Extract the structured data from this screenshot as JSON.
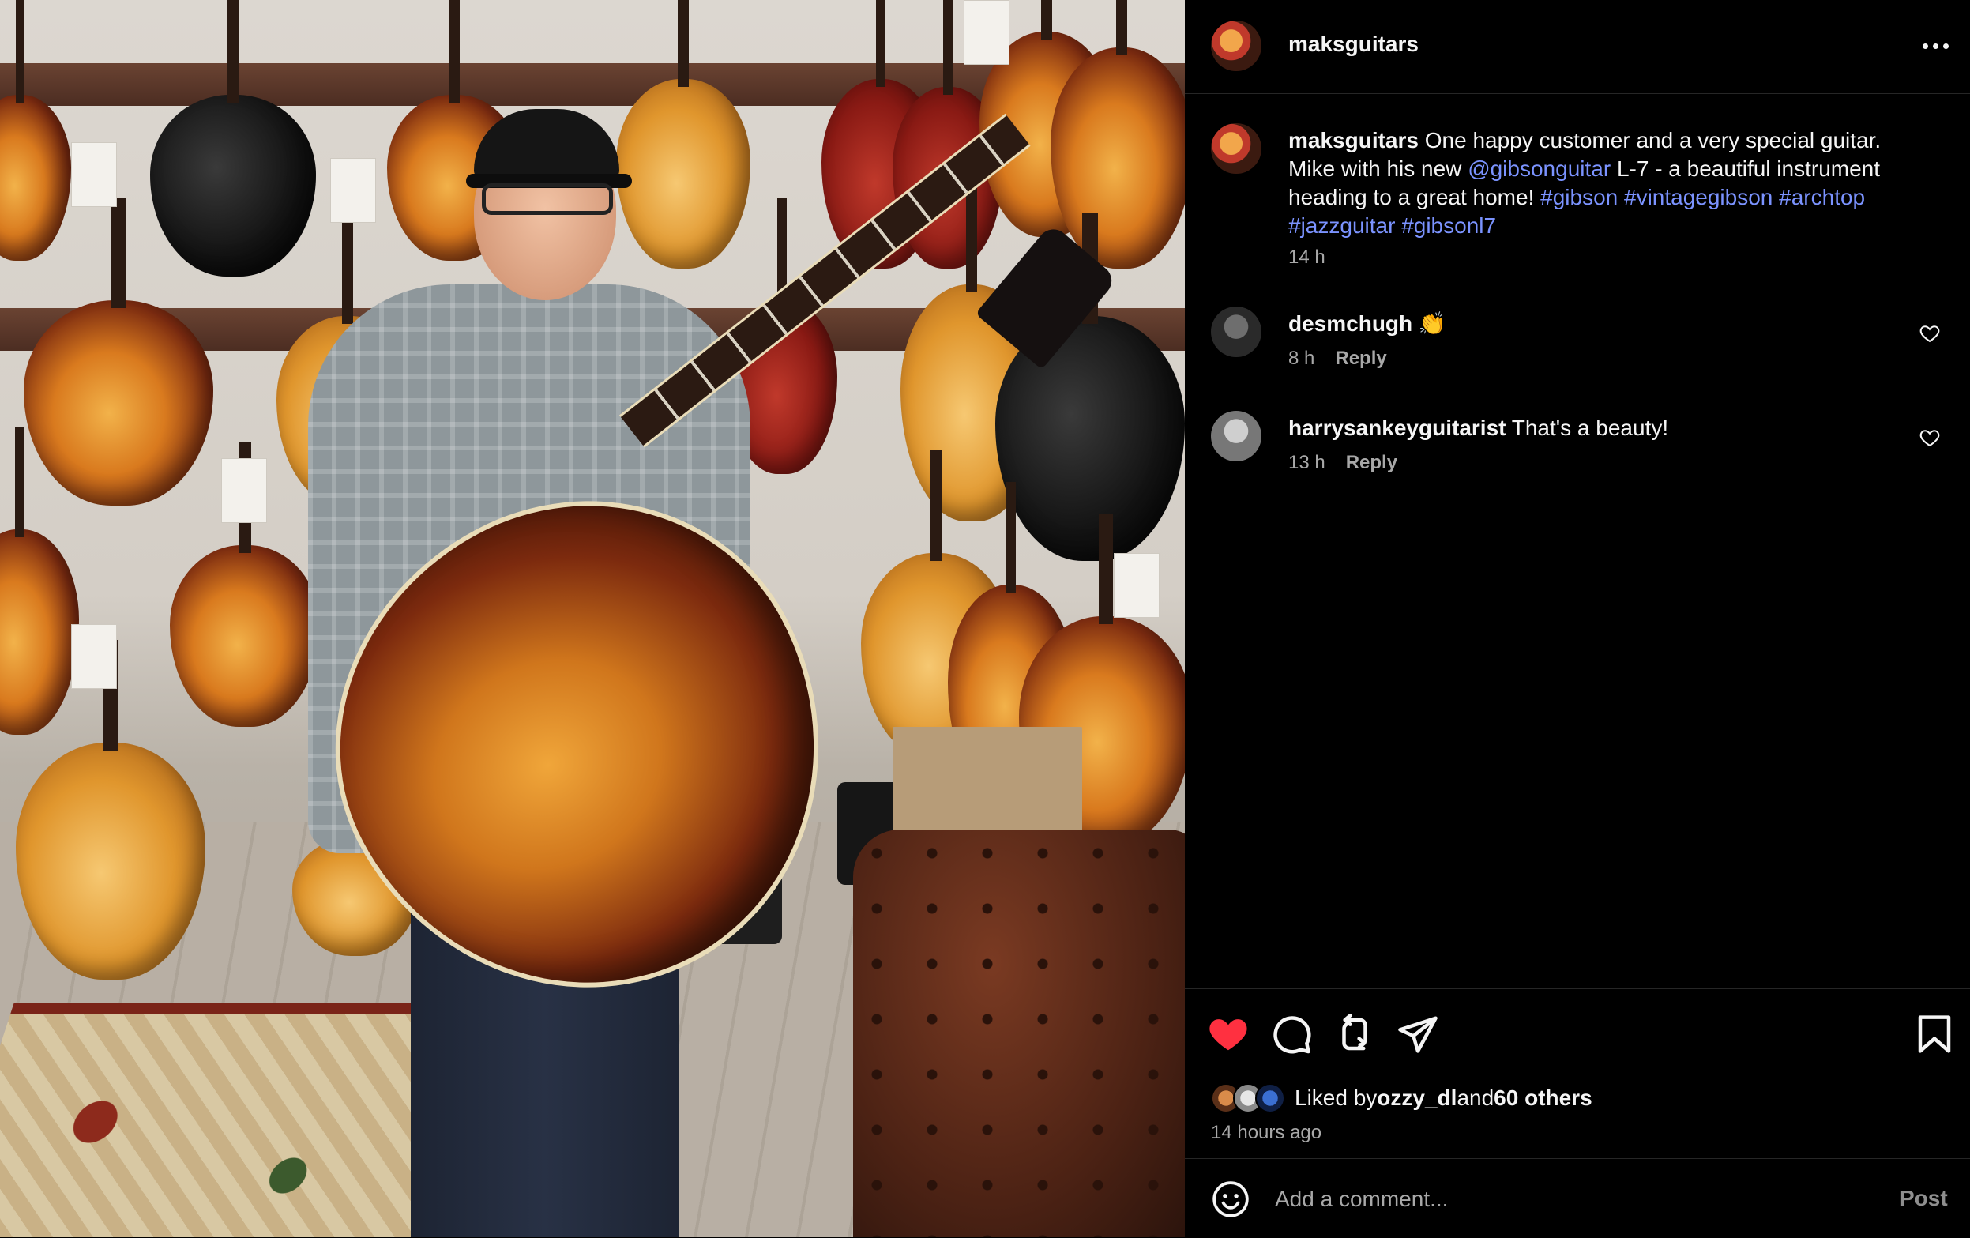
{
  "header": {
    "username": "maksguitars",
    "more_icon": "more-horizontal-icon"
  },
  "caption": {
    "username": "maksguitars",
    "text_1": " One happy customer and a very special guitar. Mike with his new ",
    "mention": "@gibsonguitar",
    "text_2": " L-7 - a beautiful instrument heading to a great home! ",
    "hashtags": [
      "#gibson",
      "#vintagegibson",
      "#archtop",
      "#jazzguitar",
      "#gibsonl7"
    ],
    "time": "14 h"
  },
  "comments": [
    {
      "username": "desmchugh",
      "text": " 👏",
      "time": "8 h",
      "reply_label": "Reply"
    },
    {
      "username": "harrysankeyguitarist",
      "text": " That's a beauty!",
      "time": "13 h",
      "reply_label": "Reply"
    }
  ],
  "actions": {
    "like_icon": "heart-filled-icon",
    "comment_icon": "comment-icon",
    "repost_icon": "repost-icon",
    "share_icon": "send-icon",
    "save_icon": "bookmark-icon",
    "like_color": "#ff3040"
  },
  "likes": {
    "prefix": "Liked by ",
    "first_liker": "ozzy_dl",
    "middle": " and ",
    "others": "60 others"
  },
  "time_ago": "14 hours ago",
  "composer": {
    "placeholder": "Add a comment...",
    "post_label": "Post"
  }
}
